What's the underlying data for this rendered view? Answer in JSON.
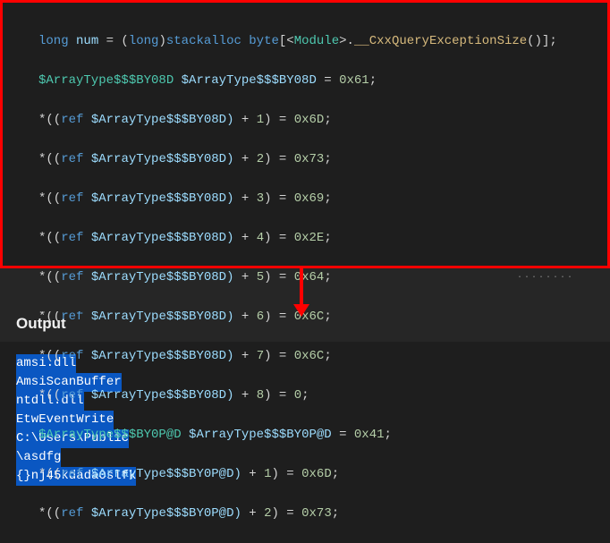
{
  "code": {
    "line1_pre": "long",
    "line1_var": " num ",
    "line1_op": "= (",
    "line1_cast": "long",
    "line1_mid": ")",
    "line1_kw": "stackalloc byte",
    "line1_br": "[<",
    "line1_mod": "Module",
    "line1_after": ">.",
    "line1_func": "__CxxQueryExceptionSize",
    "line1_end": "()];",
    "arrtype1": "$ArrayType$$$BY08D",
    "arrtype1_decl": " $ArrayType$$$BY08D ",
    "eq": "= ",
    "val0": "0x61",
    "semi": ";",
    "star": "*((",
    "ref": "ref",
    "space_arr": " $ArrayType$$$BY08D) ",
    "plus": "+ ",
    "idx1": "1",
    "val1": "0x6D",
    "idx2": "2",
    "val2": "0x73",
    "idx3": "3",
    "val3": "0x69",
    "idx4": "4",
    "val4": "0x2E",
    "idx5": "5",
    "val5": "0x64",
    "idx6": "6",
    "val6": "0x6C",
    "idx7": "7",
    "val7": "0x6C",
    "idx8": "8",
    "val8": "0",
    "close_eq": ") = ",
    "arrtype2": "$ArrayType$$$BY0P@D",
    "arrtype2_decl": " $ArrayType$$$BY0P@D ",
    "val2_0": "0x41",
    "space_arr2": " $ArrayType$$$BY0P@D) ",
    "idx2_1": "1",
    "val2_1": "0x6D",
    "idx2_2": "2",
    "val2_2": "0x73"
  },
  "dots": "........",
  "output": {
    "title": "Output",
    "items": [
      "amsi.dll",
      "AmsiScanBuffer",
      "ntdll.dll",
      "EtwEventWrite",
      "C:\\Users\\Public",
      "\\asdfg",
      "{}nj45kdada0slfk"
    ]
  }
}
